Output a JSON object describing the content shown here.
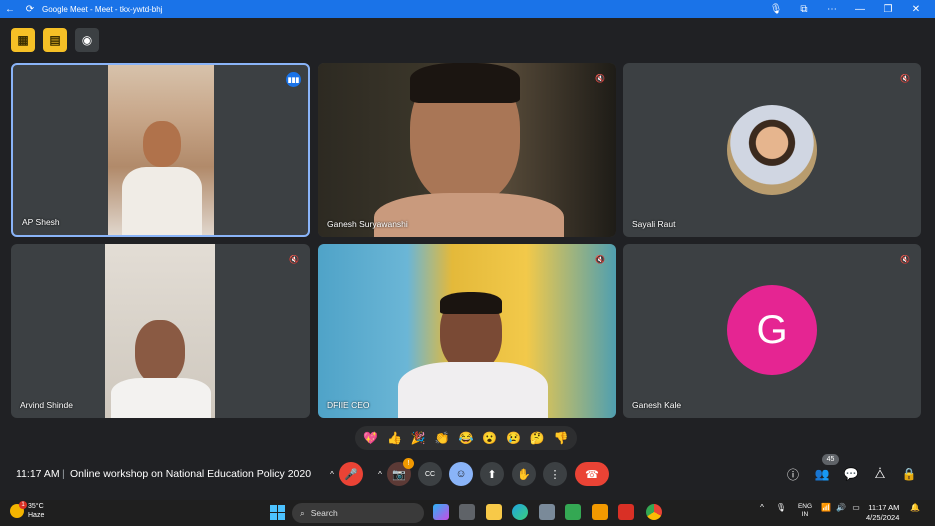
{
  "window": {
    "title": "Google Meet - Meet - tkx-ywtd-bhj",
    "back_icon": "←",
    "refresh_icon": "⟳",
    "mic_icon": "🎙",
    "cast_icon": "⧉",
    "more_icon": "⋯",
    "minimize_icon": "—",
    "maximize_icon": "❐",
    "close_icon": "✕"
  },
  "top_controls": {
    "tool1_icon": "▦",
    "tool2_icon": "▤",
    "eye_icon": "◉"
  },
  "participants": [
    {
      "name": "AP Shesh",
      "speaking": true,
      "active": true
    },
    {
      "name": "Ganesh Suryawanshi",
      "muted": true
    },
    {
      "name": "Sayali Raut",
      "muted": true
    },
    {
      "name": "Arvind Shinde",
      "muted": true
    },
    {
      "name": "DFIIE CEO",
      "muted": true
    },
    {
      "name": "Ganesh Kale",
      "muted": true,
      "initial": "G",
      "avatar_color": "#e52592"
    }
  ],
  "icons": {
    "mute": "🔇",
    "speaking": "▮▮▮"
  },
  "reactions": [
    "💖",
    "👍",
    "🎉",
    "👏",
    "😂",
    "😮",
    "😢",
    "🤔",
    "👎"
  ],
  "meeting": {
    "time": "11:17 AM",
    "separator": "|",
    "title": "Online workshop on National Education Policy 2020"
  },
  "controls": {
    "chevron": "^",
    "mic_icon": "🎤",
    "camera_icon": "📷",
    "camera_badge": "!",
    "captions_icon": "CC",
    "emoji_icon": "☺",
    "present_icon": "⬆",
    "hand_icon": "✋",
    "more_icon": "⋮",
    "end_call_icon": "☎"
  },
  "right_controls": {
    "info_icon": "ⓘ",
    "people_icon": "👥",
    "people_count": "45",
    "chat_icon": "💬",
    "activities_icon": "⧊",
    "host_controls_icon": "🔒"
  },
  "taskbar": {
    "temperature": "35°C",
    "weather": "Haze",
    "weather_badge": "1",
    "search_placeholder": "Search",
    "search_icon": "⌕",
    "language": "ENG",
    "region": "IN",
    "time": "11:17 AM",
    "date": "4/25/2024",
    "up_icon": "^",
    "wifi_icon": "📶",
    "volume_icon": "🔊",
    "battery_icon": "▭",
    "bell_icon": "🔔",
    "mic_icon": "🎙"
  },
  "colors": {
    "titlebar": "#1a73e8",
    "background": "#202124",
    "tile": "#3c4043",
    "end_call": "#ea4335",
    "accent": "#8ab4f8"
  }
}
